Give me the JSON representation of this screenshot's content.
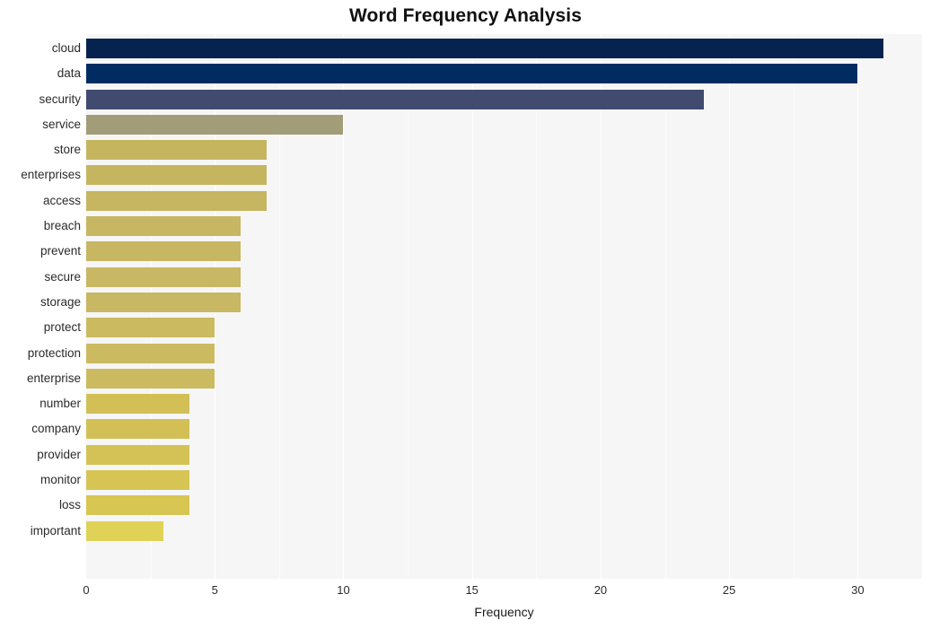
{
  "chart_data": {
    "type": "bar",
    "orientation": "horizontal",
    "title": "Word Frequency Analysis",
    "xlabel": "Frequency",
    "ylabel": "",
    "xlim": [
      0,
      32.5
    ],
    "ylim": [
      0,
      21
    ],
    "grid": true,
    "legend": null,
    "xticks": [
      0,
      5,
      10,
      15,
      20,
      25,
      30
    ],
    "xtick_labels": [
      "0",
      "5",
      "10",
      "15",
      "20",
      "25",
      "30"
    ],
    "categories": [
      "cloud",
      "data",
      "security",
      "service",
      "store",
      "enterprises",
      "access",
      "breach",
      "prevent",
      "secure",
      "storage",
      "protect",
      "protection",
      "enterprise",
      "number",
      "company",
      "provider",
      "monitor",
      "loss",
      "important"
    ],
    "values": [
      31,
      30,
      24,
      10,
      7,
      7,
      7,
      6,
      6,
      6,
      6,
      5,
      5,
      5,
      4,
      4,
      4,
      4,
      4,
      3
    ],
    "bar_colors": [
      "#06234f",
      "#012c62",
      "#414b70",
      "#a39c78",
      "#c6b55f",
      "#c6b55f",
      "#c6b561",
      "#c7b662",
      "#c7b662",
      "#c8b763",
      "#c8b763",
      "#cbba60",
      "#cbba60",
      "#cbba60",
      "#d2c057",
      "#d2c057",
      "#d4c256",
      "#d6c455",
      "#d8c653",
      "#e0d257"
    ],
    "plot_background": "#f6f6f6",
    "gridline_color": "#ffffff",
    "figure_background": "#ffffff"
  }
}
